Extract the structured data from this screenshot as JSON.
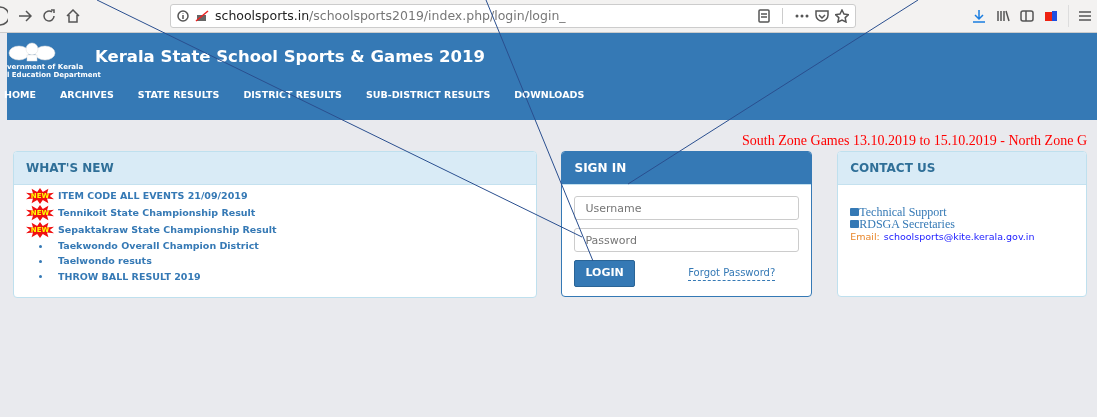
{
  "browser": {
    "url_host": "schoolsports.in",
    "url_path": "/schoolsports2019/index.php/login/login_"
  },
  "header": {
    "logo_lines": [
      "vernment of Kerala",
      "l Education Department"
    ],
    "title": "Kerala State School Sports & Games 2019"
  },
  "nav": [
    {
      "label": "HOME"
    },
    {
      "label": "ARCHIVES"
    },
    {
      "label": "STATE RESULTS"
    },
    {
      "label": "DISTRICT RESULTS"
    },
    {
      "label": "SUB-DISTRICT RESULTS"
    },
    {
      "label": "DOWNLOADS"
    }
  ],
  "marquee": "South Zone Games 13.10.2019 to 15.10.2019  - North Zone G",
  "whats_new": {
    "title": "WHAT'S NEW",
    "items": [
      {
        "kind": "new",
        "badge": "NEW",
        "text": "ITEM CODE ALL EVENTS 21/09/2019"
      },
      {
        "kind": "new",
        "badge": "NEW",
        "text": "Tennikoit State Championship Result"
      },
      {
        "kind": "new",
        "badge": "NEW",
        "text": "Sepaktakraw State Championship Result"
      },
      {
        "kind": "bullet",
        "text": "Taekwondo Overall Champion District"
      },
      {
        "kind": "bullet",
        "text": "Taelwondo resuts"
      },
      {
        "kind": "bullet",
        "text": "THROW BALL RESULT 2019"
      }
    ]
  },
  "sign_in": {
    "title": "SIGN IN",
    "username_placeholder": "Username",
    "password_placeholder": "Password",
    "button": "LOGIN",
    "forgot": "Forgot Password?"
  },
  "contact": {
    "title": "CONTACT US",
    "links": [
      "Technical Support",
      "RDSGA Secretaries"
    ],
    "email_label": "Email:",
    "email": "schoolsports@kite.kerala.gov.in"
  }
}
